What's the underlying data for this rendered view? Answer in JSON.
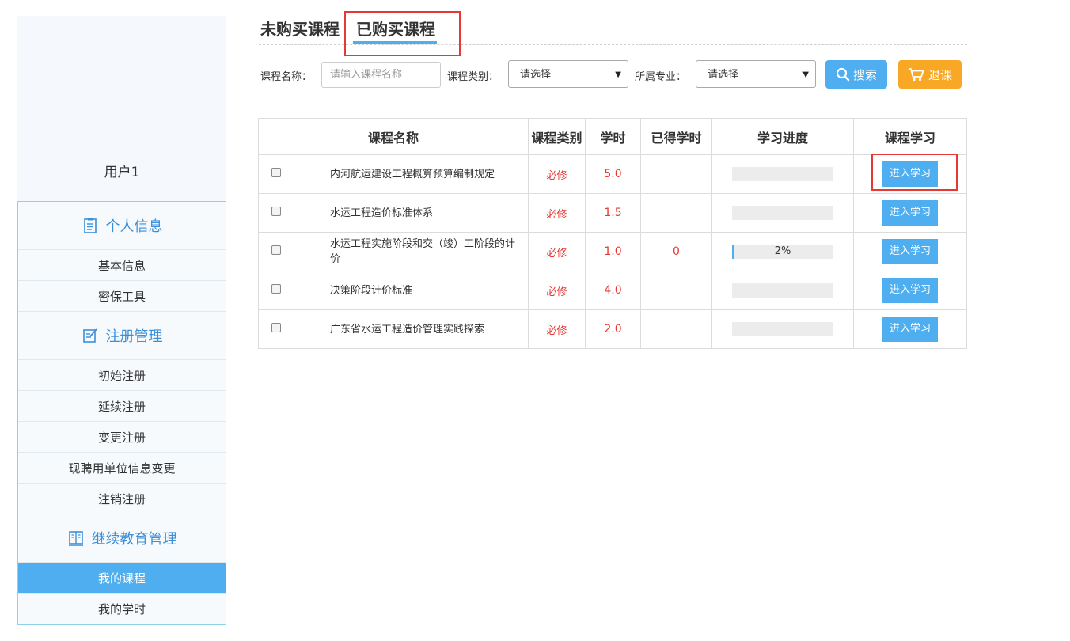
{
  "sidebar": {
    "user_name": "用户1",
    "sections": [
      {
        "title": "个人信息",
        "icon": "clipboard-icon",
        "items": [
          "基本信息",
          "密保工具"
        ]
      },
      {
        "title": "注册管理",
        "icon": "edit-note-icon",
        "items": [
          "初始注册",
          "延续注册",
          "变更注册",
          "现聘用单位信息变更",
          "注销注册"
        ]
      },
      {
        "title": "继续教育管理",
        "icon": "book-icon",
        "items": [
          "我的课程",
          "我的学时"
        ]
      }
    ],
    "active_item": "我的课程"
  },
  "tabs": {
    "unbought": "未购买课程",
    "bought": "已购买课程",
    "active": "已购买课程"
  },
  "filters": {
    "name_label": "课程名称：",
    "name_placeholder": "请输入课程名称",
    "type_label": "课程类别：",
    "type_value": "请选择",
    "major_label": "所属专业：",
    "major_value": "请选择",
    "search_button": "搜索",
    "drop_button": "退课"
  },
  "table": {
    "headers": [
      "课程名称",
      "课程类别",
      "学时",
      "已得学时",
      "学习进度",
      "课程学习"
    ],
    "study_label": "进入学习",
    "rows": [
      {
        "name": "内河航运建设工程概算预算编制规定",
        "type": "必修",
        "hours": "5.0",
        "earned": "",
        "progress": 0,
        "progress_text": ""
      },
      {
        "name": "水运工程造价标准体系",
        "type": "必修",
        "hours": "1.5",
        "earned": "",
        "progress": 0,
        "progress_text": ""
      },
      {
        "name": "水运工程实施阶段和交（竣）工阶段的计价",
        "type": "必修",
        "hours": "1.0",
        "earned": "0",
        "progress": 2,
        "progress_text": "2%"
      },
      {
        "name": "决策阶段计价标准",
        "type": "必修",
        "hours": "4.0",
        "earned": "",
        "progress": 0,
        "progress_text": ""
      },
      {
        "name": "广东省水运工程造价管理实践探索",
        "type": "必修",
        "hours": "2.0",
        "earned": "",
        "progress": 0,
        "progress_text": ""
      }
    ]
  },
  "colors": {
    "accent": "#4faeef",
    "warning": "#f9a825",
    "required": "#e53935",
    "highlight_box": "#e53935"
  }
}
